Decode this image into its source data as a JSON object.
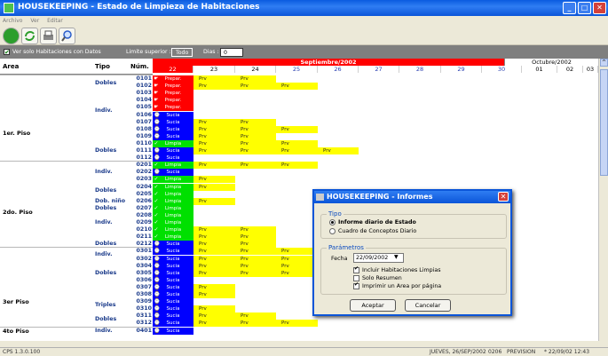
{
  "title": "HOUSEKEEPING - Estado de Limpieza de Habitaciones",
  "menu": [
    "Archivo",
    "Ver",
    "Editar"
  ],
  "filters": {
    "check_label": "Ver solo Habitaciones con Datos",
    "limite_label": "Limite superior :",
    "limite_value": "Todo",
    "dias_label": "Dias :",
    "dias_value": "0"
  },
  "headers": {
    "area": "Area",
    "tipo": "Tipo",
    "num": "Núm."
  },
  "months": {
    "current": "Septiembre/2002",
    "next": "Octubre/2002"
  },
  "days": [
    "22",
    "23",
    "24",
    "25",
    "26",
    "27",
    "28",
    "29",
    "30",
    "01",
    "02",
    "03"
  ],
  "status_labels": {
    "prep": "Prepar.",
    "sucia": "Sucia",
    "limpia": "Limpia",
    "prv": "Prv"
  },
  "areas": [
    {
      "name": "1er. Piso"
    },
    {
      "name": "2do. Piso"
    },
    {
      "name": "3er Piso"
    },
    {
      "name": "4to Piso"
    }
  ],
  "tipos": [
    {
      "label": "Dobles"
    },
    {
      "label": "Indiv."
    },
    {
      "label": "Dobles"
    },
    {
      "label": "Indiv."
    },
    {
      "label": "Dobles"
    },
    {
      "label": "Dob. niño"
    },
    {
      "label": "Dobles"
    },
    {
      "label": "Indiv."
    },
    {
      "label": "Dobles"
    },
    {
      "label": "Indiv."
    },
    {
      "label": "Dobles"
    },
    {
      "label": "Triples"
    },
    {
      "label": "Dobles"
    },
    {
      "label": "Indiv."
    }
  ],
  "rooms": [
    {
      "n": "0101",
      "s": "prep",
      "p": [
        1,
        2
      ]
    },
    {
      "n": "0102",
      "s": "prep",
      "p": [
        1,
        2,
        3
      ]
    },
    {
      "n": "0103",
      "s": "prep",
      "p": []
    },
    {
      "n": "0104",
      "s": "prep",
      "p": []
    },
    {
      "n": "0105",
      "s": "prep",
      "p": []
    },
    {
      "n": "0106",
      "s": "sucia",
      "p": []
    },
    {
      "n": "0107",
      "s": "sucia",
      "p": [
        1,
        2
      ]
    },
    {
      "n": "0108",
      "s": "sucia",
      "p": [
        1,
        2,
        3
      ]
    },
    {
      "n": "0109",
      "s": "sucia",
      "p": [
        1,
        2
      ]
    },
    {
      "n": "0110",
      "s": "limpia",
      "p": [
        1,
        2,
        3
      ]
    },
    {
      "n": "0111",
      "s": "sucia",
      "p": [
        1,
        2,
        3,
        4
      ]
    },
    {
      "n": "0112",
      "s": "sucia",
      "p": []
    },
    {
      "n": "0201",
      "s": "limpia",
      "p": [
        1,
        2,
        3
      ]
    },
    {
      "n": "0202",
      "s": "sucia",
      "p": []
    },
    {
      "n": "0203",
      "s": "limpia",
      "p": [
        1
      ]
    },
    {
      "n": "0204",
      "s": "limpia",
      "p": [
        1
      ]
    },
    {
      "n": "0205",
      "s": "limpia",
      "p": []
    },
    {
      "n": "0206",
      "s": "limpia",
      "p": [
        1
      ]
    },
    {
      "n": "0207",
      "s": "limpia",
      "p": []
    },
    {
      "n": "0208",
      "s": "limpia",
      "p": []
    },
    {
      "n": "0209",
      "s": "limpia",
      "p": []
    },
    {
      "n": "0210",
      "s": "limpia",
      "p": [
        1,
        2
      ]
    },
    {
      "n": "0211",
      "s": "limpia",
      "p": [
        1,
        2
      ]
    },
    {
      "n": "0212",
      "s": "sucia",
      "p": [
        1,
        2
      ]
    },
    {
      "n": "0301",
      "s": "sucia",
      "p": [
        1,
        2,
        3
      ]
    },
    {
      "n": "0302",
      "s": "sucia",
      "p": [
        1,
        2,
        3
      ]
    },
    {
      "n": "0304",
      "s": "sucia",
      "p": [
        1,
        2,
        3
      ]
    },
    {
      "n": "0305",
      "s": "sucia",
      "p": [
        1,
        2,
        3
      ]
    },
    {
      "n": "0306",
      "s": "sucia",
      "p": []
    },
    {
      "n": "0307",
      "s": "sucia",
      "p": [
        1
      ]
    },
    {
      "n": "0308",
      "s": "sucia",
      "p": [
        1
      ]
    },
    {
      "n": "0309",
      "s": "sucia",
      "p": []
    },
    {
      "n": "0310",
      "s": "sucia",
      "p": [
        1
      ]
    },
    {
      "n": "0311",
      "s": "sucia",
      "p": [
        1,
        2
      ]
    },
    {
      "n": "0312",
      "s": "sucia",
      "p": [
        1,
        2,
        3
      ]
    },
    {
      "n": "0401",
      "s": "sucia",
      "p": []
    }
  ],
  "dialog": {
    "title": "HOUSEKEEPING - Informes",
    "tipo_legend": "Tipo",
    "opt1": "Informe diario de Estado",
    "opt2": "Cuadro de Conceptos Diario",
    "param_legend": "Parámetros",
    "fecha_label": "Fecha",
    "fecha_value": "22/09/2002",
    "cb1": "Incluir Habitaciones Limpias",
    "cb2": "Solo Resumen",
    "cb3": "Imprimir un Area por página",
    "ok": "Aceptar",
    "cancel": "Cancelar"
  },
  "status": {
    "version": "CPS 1.3.0.100",
    "date": "JUEVES, 26/SEP/2002",
    "code": "0206",
    "mode": "PREVISION",
    "stamp": "* 22/09/02 12:43"
  },
  "colors": {
    "prep": "#ff0000",
    "sucia": "#0000ff",
    "limpia": "#00e000",
    "prv": "#ffff00",
    "month": "#ff0000",
    "title": "#0b55d8"
  }
}
